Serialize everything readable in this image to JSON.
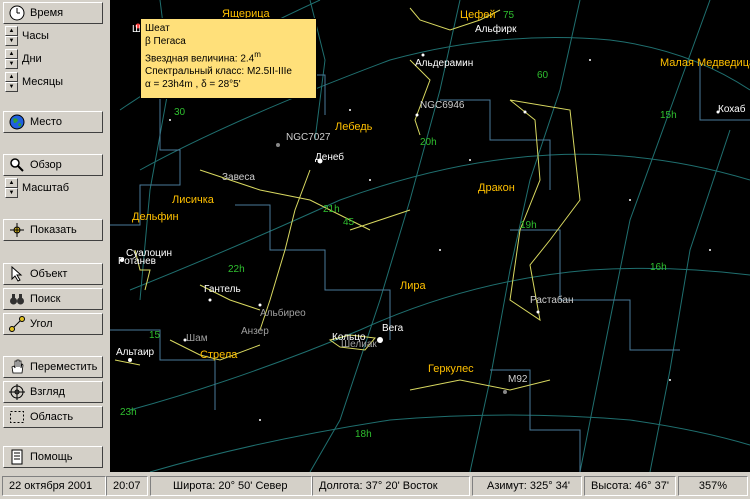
{
  "sidebar": {
    "time_label": "Время",
    "hours_label": "Часы",
    "days_label": "Дни",
    "months_label": "Месяцы",
    "place_label": "Место",
    "overview_label": "Обзор",
    "scale_label": "Масштаб",
    "show_label": "Показать",
    "object_label": "Объект",
    "search_label": "Поиск",
    "angle_label": "Угол",
    "move_label": "Переместить",
    "look_label": "Взгляд",
    "area_label": "Область",
    "help_label": "Помощь"
  },
  "tooltip": {
    "name": "Шеат",
    "designation": "β Пегаса",
    "magnitude_prefix": "Звездная  величина: 2.4",
    "magnitude_sup": "m",
    "spectral": "Спектральный  класс: M2.5II-IIIe",
    "coords": "α = 23h4m ,  δ = 28°5'"
  },
  "sky": {
    "constellations": [
      "Ящерица",
      "Цефей",
      "Малая Медведица",
      "Лебедь",
      "Лисичка",
      "Дельфин",
      "Лира",
      "Дракон",
      "Стрела",
      "Геркулес"
    ],
    "stars": [
      "Альдерамин",
      "Альфирк",
      "Кохаб",
      "Денеб",
      "Суалоцин",
      "Ротанев",
      "Гантель",
      "Альбирео",
      "Шам",
      "Анзер",
      "Кольцо",
      "Шелиак",
      "Вега",
      "Альтаир",
      "Растабан",
      "Шеат"
    ],
    "objects": [
      "NGC6946",
      "NGC7027",
      "M92",
      "Завеса"
    ],
    "grid_labels": [
      "75",
      "60",
      "45",
      "30",
      "15",
      "20h",
      "19h",
      "18h",
      "16h",
      "15h",
      "21h",
      "22h",
      "23h"
    ]
  },
  "status": {
    "date": "22 октября 2001",
    "time": "20:07",
    "latitude": "Широта: 20° 50' Север",
    "longitude": "Долгота: 37° 20' Восток",
    "azimuth": "Азимут: 325° 34'",
    "altitude": "Высота: 46° 37'",
    "zoom": "357%"
  },
  "colors": {
    "sky": "#000000",
    "grid": "#1f6f6f",
    "grid_label": "#2fbf2f",
    "constellation_line": "#d8d860",
    "constellation_name": "#ffc000",
    "star_label": "#ffffff",
    "tooltip_bg": "#ffe07a"
  }
}
